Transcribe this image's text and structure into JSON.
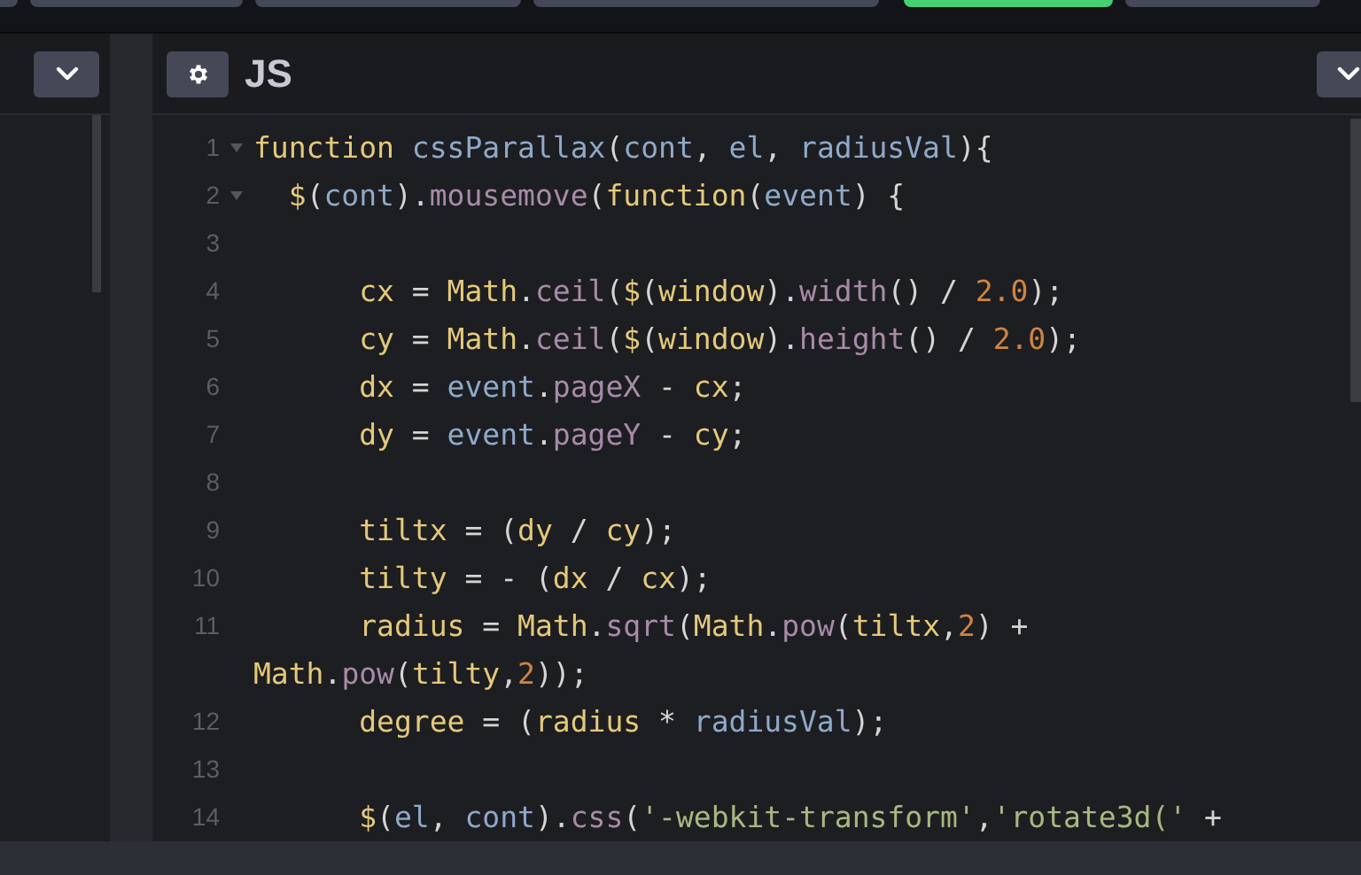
{
  "top_buttons": [
    {
      "color": "#444857"
    },
    {
      "color": "#444857"
    },
    {
      "color": "#444857"
    },
    {
      "color": "#444857"
    },
    {
      "color": "#47cf73"
    },
    {
      "color": "#444857"
    }
  ],
  "editor": {
    "title": "JS",
    "lines": [
      {
        "number": "1",
        "foldable": true,
        "tokens": [
          {
            "kind": "keyword",
            "text": "function"
          },
          {
            "kind": "variable",
            "text": " cssParallax"
          },
          {
            "kind": "plain",
            "text": "("
          },
          {
            "kind": "variable",
            "text": "cont"
          },
          {
            "kind": "plain",
            "text": ", "
          },
          {
            "kind": "variable",
            "text": "el"
          },
          {
            "kind": "plain",
            "text": ", "
          },
          {
            "kind": "variable",
            "text": "radiusVal"
          },
          {
            "kind": "plain",
            "text": "){"
          }
        ]
      },
      {
        "number": "2",
        "foldable": true,
        "tokens": [
          {
            "kind": "keyword",
            "text": "  $"
          },
          {
            "kind": "plain",
            "text": "("
          },
          {
            "kind": "variable",
            "text": "cont"
          },
          {
            "kind": "plain",
            "text": ")."
          },
          {
            "kind": "property",
            "text": "mousemove"
          },
          {
            "kind": "plain",
            "text": "("
          },
          {
            "kind": "keyword",
            "text": "function"
          },
          {
            "kind": "plain",
            "text": "("
          },
          {
            "kind": "variable",
            "text": "event"
          },
          {
            "kind": "plain",
            "text": ") {"
          }
        ]
      },
      {
        "number": "3",
        "foldable": false
      },
      {
        "number": "4",
        "foldable": false,
        "tokens": [
          {
            "kind": "keyword",
            "text": "      cx"
          },
          {
            "kind": "plain",
            "text": " = "
          },
          {
            "kind": "keyword",
            "text": "Math"
          },
          {
            "kind": "plain",
            "text": "."
          },
          {
            "kind": "property",
            "text": "ceil"
          },
          {
            "kind": "plain",
            "text": "("
          },
          {
            "kind": "keyword",
            "text": "$"
          },
          {
            "kind": "plain",
            "text": "("
          },
          {
            "kind": "keyword",
            "text": "window"
          },
          {
            "kind": "plain",
            "text": ")."
          },
          {
            "kind": "property",
            "text": "width"
          },
          {
            "kind": "plain",
            "text": "() / "
          },
          {
            "kind": "number",
            "text": "2.0"
          },
          {
            "kind": "plain",
            "text": ");"
          }
        ]
      },
      {
        "number": "5",
        "foldable": false,
        "tokens": [
          {
            "kind": "keyword",
            "text": "      cy"
          },
          {
            "kind": "plain",
            "text": " = "
          },
          {
            "kind": "keyword",
            "text": "Math"
          },
          {
            "kind": "plain",
            "text": "."
          },
          {
            "kind": "property",
            "text": "ceil"
          },
          {
            "kind": "plain",
            "text": "("
          },
          {
            "kind": "keyword",
            "text": "$"
          },
          {
            "kind": "plain",
            "text": "("
          },
          {
            "kind": "keyword",
            "text": "window"
          },
          {
            "kind": "plain",
            "text": ")."
          },
          {
            "kind": "property",
            "text": "height"
          },
          {
            "kind": "plain",
            "text": "() / "
          },
          {
            "kind": "number",
            "text": "2.0"
          },
          {
            "kind": "plain",
            "text": ");"
          }
        ]
      },
      {
        "number": "6",
        "foldable": false,
        "tokens": [
          {
            "kind": "keyword",
            "text": "      dx"
          },
          {
            "kind": "plain",
            "text": " = "
          },
          {
            "kind": "variable",
            "text": "event"
          },
          {
            "kind": "plain",
            "text": "."
          },
          {
            "kind": "property",
            "text": "pageX"
          },
          {
            "kind": "plain",
            "text": " - "
          },
          {
            "kind": "keyword",
            "text": "cx"
          },
          {
            "kind": "plain",
            "text": ";"
          }
        ]
      },
      {
        "number": "7",
        "foldable": false,
        "tokens": [
          {
            "kind": "keyword",
            "text": "      dy"
          },
          {
            "kind": "plain",
            "text": " = "
          },
          {
            "kind": "variable",
            "text": "event"
          },
          {
            "kind": "plain",
            "text": "."
          },
          {
            "kind": "property",
            "text": "pageY"
          },
          {
            "kind": "plain",
            "text": " - "
          },
          {
            "kind": "keyword",
            "text": "cy"
          },
          {
            "kind": "plain",
            "text": ";"
          }
        ]
      },
      {
        "number": "8",
        "foldable": false
      },
      {
        "number": "9",
        "foldable": false,
        "tokens": [
          {
            "kind": "keyword",
            "text": "      tiltx"
          },
          {
            "kind": "plain",
            "text": " = ("
          },
          {
            "kind": "keyword",
            "text": "dy"
          },
          {
            "kind": "plain",
            "text": " / "
          },
          {
            "kind": "keyword",
            "text": "cy"
          },
          {
            "kind": "plain",
            "text": ");"
          }
        ]
      },
      {
        "number": "10",
        "foldable": false,
        "tokens": [
          {
            "kind": "keyword",
            "text": "      tilty"
          },
          {
            "kind": "plain",
            "text": " = - ("
          },
          {
            "kind": "keyword",
            "text": "dx"
          },
          {
            "kind": "plain",
            "text": " / "
          },
          {
            "kind": "keyword",
            "text": "cx"
          },
          {
            "kind": "plain",
            "text": ");"
          }
        ]
      },
      {
        "number": "11",
        "foldable": false,
        "tokens": [
          {
            "kind": "keyword",
            "text": "      radius"
          },
          {
            "kind": "plain",
            "text": " = "
          },
          {
            "kind": "keyword",
            "text": "Math"
          },
          {
            "kind": "plain",
            "text": "."
          },
          {
            "kind": "property",
            "text": "sqrt"
          },
          {
            "kind": "plain",
            "text": "("
          },
          {
            "kind": "keyword",
            "text": "Math"
          },
          {
            "kind": "plain",
            "text": "."
          },
          {
            "kind": "property",
            "text": "pow"
          },
          {
            "kind": "plain",
            "text": "("
          },
          {
            "kind": "keyword",
            "text": "tiltx"
          },
          {
            "kind": "plain",
            "text": ","
          },
          {
            "kind": "number",
            "text": "2"
          },
          {
            "kind": "plain",
            "text": ") +"
          }
        ],
        "continuation": [
          {
            "kind": "keyword",
            "text": "Math"
          },
          {
            "kind": "plain",
            "text": "."
          },
          {
            "kind": "property",
            "text": "pow"
          },
          {
            "kind": "plain",
            "text": "("
          },
          {
            "kind": "keyword",
            "text": "tilty"
          },
          {
            "kind": "plain",
            "text": ","
          },
          {
            "kind": "number",
            "text": "2"
          },
          {
            "kind": "plain",
            "text": "));"
          }
        ]
      },
      {
        "number": "12",
        "foldable": false,
        "tokens": [
          {
            "kind": "keyword",
            "text": "      degree"
          },
          {
            "kind": "plain",
            "text": " = ("
          },
          {
            "kind": "keyword",
            "text": "radius"
          },
          {
            "kind": "plain",
            "text": " * "
          },
          {
            "kind": "variable",
            "text": "radiusVal"
          },
          {
            "kind": "plain",
            "text": ");"
          }
        ]
      },
      {
        "number": "13",
        "foldable": false
      },
      {
        "number": "14",
        "foldable": false,
        "tokens": [
          {
            "kind": "keyword",
            "text": "      $"
          },
          {
            "kind": "plain",
            "text": "("
          },
          {
            "kind": "variable",
            "text": "el"
          },
          {
            "kind": "plain",
            "text": ", "
          },
          {
            "kind": "variable",
            "text": "cont"
          },
          {
            "kind": "plain",
            "text": ")."
          },
          {
            "kind": "property",
            "text": "css"
          },
          {
            "kind": "plain",
            "text": "("
          },
          {
            "kind": "string",
            "text": "'-webkit-transform'"
          },
          {
            "kind": "plain",
            "text": ","
          },
          {
            "kind": "string",
            "text": "'rotate3d('"
          },
          {
            "kind": "plain",
            "text": " +"
          }
        ]
      }
    ]
  }
}
